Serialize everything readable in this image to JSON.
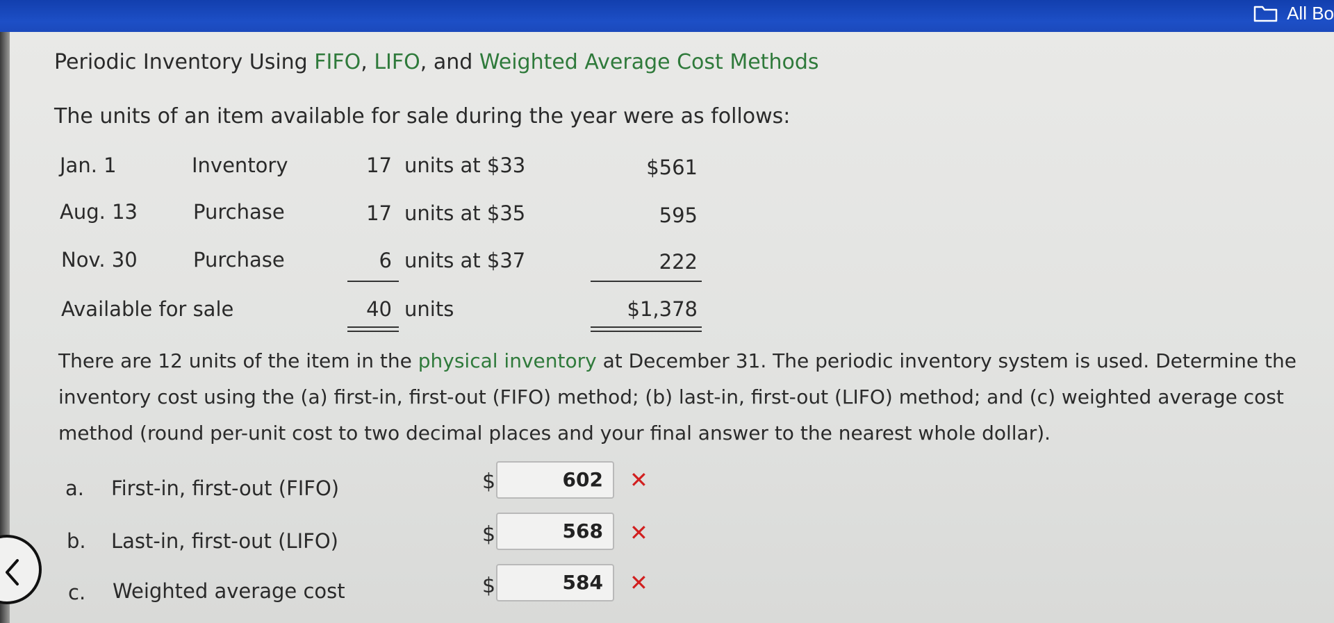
{
  "topbar": {
    "button_label": "All Bo"
  },
  "title": {
    "prefix": "Periodic Inventory Using ",
    "fifo": "FIFO",
    "sep1": ", ",
    "lifo": "LIFO",
    "sep2": ", and ",
    "wac": "Weighted Average Cost Methods"
  },
  "intro": "The units of an item available for sale during the year were as follows:",
  "table": {
    "rows": [
      {
        "date": "Jan. 1",
        "desc": "Inventory",
        "units": "17",
        "rate": "units at $33",
        "cost": "$561"
      },
      {
        "date": "Aug. 13",
        "desc": "Purchase",
        "units": "17",
        "rate": "units at $35",
        "cost": "595"
      },
      {
        "date": "Nov. 30",
        "desc": "Purchase",
        "units": "6",
        "rate": "units at $37",
        "cost": "222"
      }
    ],
    "total": {
      "label": "Available for sale",
      "units": "40",
      "units_label": "units",
      "cost": "$1,378"
    }
  },
  "paragraph": {
    "part1": "There are 12 units of the item in the ",
    "link": "physical inventory",
    "part2": " at December 31. The periodic inventory system is used. Determine the inventory cost using the (a) first-in, first-out (FIFO) method; (b) last-in, first-out (LIFO) method; and (c) weighted average cost method (round per-unit cost to two decimal places and your final answer to the nearest whole dollar)."
  },
  "answers": [
    {
      "letter": "a.",
      "label": "First-in, first-out (FIFO)",
      "currency": "$",
      "value": "602",
      "status": "incorrect",
      "mark": "✕"
    },
    {
      "letter": "b.",
      "label": "Last-in, first-out (LIFO)",
      "currency": "$",
      "value": "568",
      "status": "incorrect",
      "mark": "✕"
    },
    {
      "letter": "c.",
      "label": "Weighted average cost",
      "currency": "$",
      "value": "584",
      "status": "incorrect",
      "mark": "✕"
    }
  ],
  "colors": {
    "topbar": "#1d4fc6",
    "link_green": "#2f7a3b",
    "incorrect_red": "#d11f1f"
  },
  "icons": {
    "topbar": "folder-icon",
    "back": "chevron-left-icon",
    "incorrect": "x-mark-icon"
  }
}
